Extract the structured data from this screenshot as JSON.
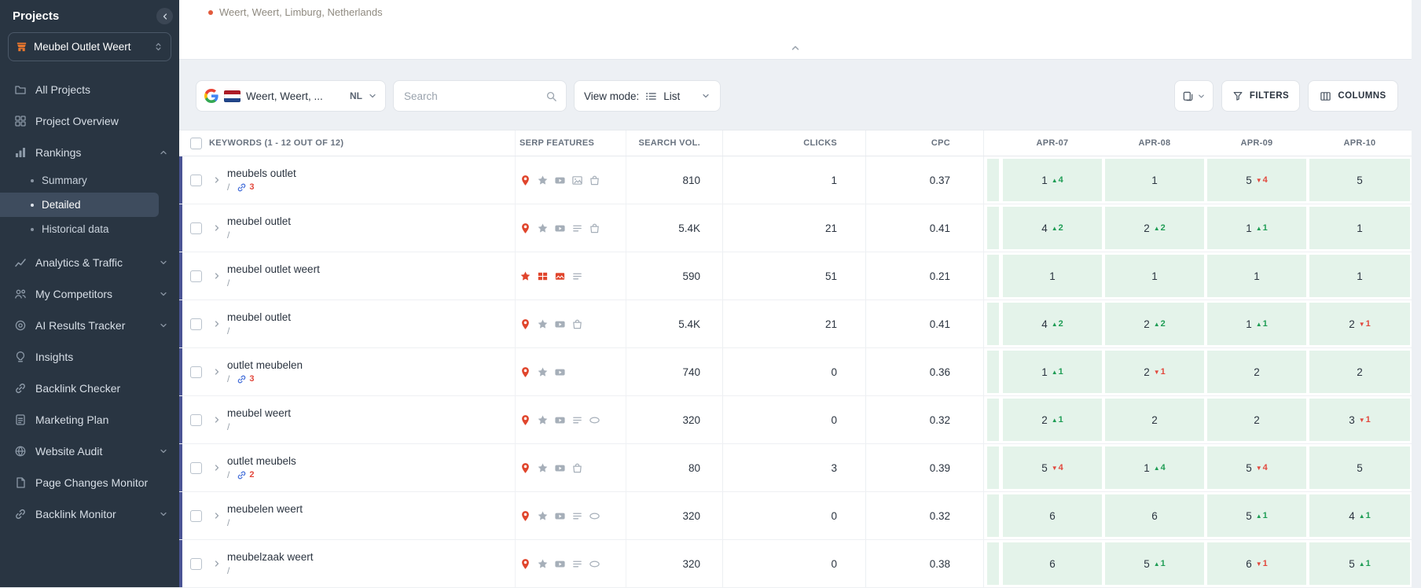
{
  "colors": {
    "positive": "#1f9d55",
    "negative": "#e2483d",
    "accent_bar": "#4a5494",
    "date_cell_bg": "#e4f3ea",
    "serp_red": "#e0452c",
    "serp_gray": "#a6afb9",
    "link_blue": "#3f6ad8",
    "sidebar_bg": "#293542",
    "location_dot": "#e25a3c"
  },
  "sidebar": {
    "title": "Projects",
    "project_name": "Meubel Outlet Weert",
    "items": [
      {
        "label": "All Projects",
        "icon": "folder"
      },
      {
        "label": "Project Overview",
        "icon": "overview"
      },
      {
        "label": "Rankings",
        "icon": "rankings",
        "expanded": true,
        "children": [
          {
            "label": "Summary"
          },
          {
            "label": "Detailed",
            "active": true
          },
          {
            "label": "Historical data"
          }
        ]
      },
      {
        "label": "Analytics & Traffic",
        "icon": "analytics",
        "expandable": true
      },
      {
        "label": "My Competitors",
        "icon": "competitors",
        "expandable": true
      },
      {
        "label": "AI Results Tracker",
        "icon": "ai-tracker",
        "expandable": true
      },
      {
        "label": "Insights",
        "icon": "insights"
      },
      {
        "label": "Backlink Checker",
        "icon": "link"
      },
      {
        "label": "Marketing Plan",
        "icon": "marketing"
      },
      {
        "label": "Website Audit",
        "icon": "website-audit",
        "expandable": true
      },
      {
        "label": "Page Changes Monitor",
        "icon": "page-changes"
      },
      {
        "label": "Backlink Monitor",
        "icon": "link",
        "expandable": true
      }
    ]
  },
  "header_panel": {
    "location_full": "Weert, Weert, Limburg, Netherlands"
  },
  "toolbar": {
    "location": {
      "engine_icon": "google-g",
      "flag_icon": "flag-nl",
      "label": "Weert, Weert, ...",
      "country_code": "NL"
    },
    "search": {
      "placeholder": "Search",
      "icon": "magnifier"
    },
    "view_mode": {
      "label": "View mode:",
      "icon": "view-list",
      "value": "List"
    },
    "export": {
      "icon": "copy"
    },
    "filters": {
      "label": "FILTERS",
      "icon": "funnel"
    },
    "columns": {
      "label": "COLUMNS",
      "icon": "columns"
    }
  },
  "table": {
    "headers": {
      "keywords": "KEYWORDS (1 - 12 OUT OF 12)",
      "serp": "SERP FEATURES",
      "volume": "SEARCH VOL.",
      "clicks": "CLICKS",
      "cpc": "CPC",
      "dates": [
        "APR-07",
        "APR-08",
        "APR-09",
        "APR-10"
      ]
    },
    "rows": [
      {
        "keyword": "meubels outlet",
        "url": "/",
        "links": "3",
        "serp": [
          {
            "icon": "map-pin",
            "color": "red"
          },
          {
            "icon": "star",
            "color": "gray"
          },
          {
            "icon": "video",
            "color": "gray"
          },
          {
            "icon": "image",
            "color": "gray"
          },
          {
            "icon": "bag",
            "color": "gray"
          }
        ],
        "volume": "810",
        "clicks": "1",
        "cpc": "0.37",
        "positions": [
          {
            "value": "1",
            "change": "4",
            "dir": "up"
          },
          {
            "value": "1"
          },
          {
            "value": "5",
            "change": "4",
            "dir": "down"
          },
          {
            "value": "5"
          }
        ]
      },
      {
        "keyword": "meubel outlet",
        "url": "/",
        "serp": [
          {
            "icon": "map-pin",
            "color": "red"
          },
          {
            "icon": "star",
            "color": "gray"
          },
          {
            "icon": "video",
            "color": "gray"
          },
          {
            "icon": "list",
            "color": "gray"
          },
          {
            "icon": "bag",
            "color": "gray"
          }
        ],
        "volume": "5.4K",
        "clicks": "21",
        "cpc": "0.41",
        "positions": [
          {
            "value": "4",
            "change": "2",
            "dir": "up"
          },
          {
            "value": "2",
            "change": "2",
            "dir": "up"
          },
          {
            "value": "1",
            "change": "1",
            "dir": "up"
          },
          {
            "value": "1"
          }
        ]
      },
      {
        "keyword": "meubel outlet weert",
        "url": "/",
        "serp": [
          {
            "icon": "star",
            "color": "red"
          },
          {
            "icon": "table",
            "color": "red"
          },
          {
            "icon": "image-pack",
            "color": "red"
          },
          {
            "icon": "list",
            "color": "gray"
          }
        ],
        "volume": "590",
        "clicks": "51",
        "cpc": "0.21",
        "positions": [
          {
            "value": "1"
          },
          {
            "value": "1"
          },
          {
            "value": "1"
          },
          {
            "value": "1"
          }
        ]
      },
      {
        "keyword": "meubel outlet",
        "url": "/",
        "serp": [
          {
            "icon": "map-pin",
            "color": "red"
          },
          {
            "icon": "star",
            "color": "gray"
          },
          {
            "icon": "video",
            "color": "gray"
          },
          {
            "icon": "bag",
            "color": "gray"
          }
        ],
        "volume": "5.4K",
        "clicks": "21",
        "cpc": "0.41",
        "positions": [
          {
            "value": "4",
            "change": "2",
            "dir": "up"
          },
          {
            "value": "2",
            "change": "2",
            "dir": "up"
          },
          {
            "value": "1",
            "change": "1",
            "dir": "up"
          },
          {
            "value": "2",
            "change": "1",
            "dir": "down"
          }
        ]
      },
      {
        "keyword": "outlet meubelen",
        "url": "/",
        "links": "3",
        "serp": [
          {
            "icon": "map-pin",
            "color": "red"
          },
          {
            "icon": "star",
            "color": "gray"
          },
          {
            "icon": "video",
            "color": "gray"
          }
        ],
        "volume": "740",
        "clicks": "0",
        "cpc": "0.36",
        "positions": [
          {
            "value": "1",
            "change": "1",
            "dir": "up"
          },
          {
            "value": "2",
            "change": "1",
            "dir": "down"
          },
          {
            "value": "2"
          },
          {
            "value": "2"
          }
        ]
      },
      {
        "keyword": "meubel weert",
        "url": "/",
        "serp": [
          {
            "icon": "map-pin",
            "color": "red"
          },
          {
            "icon": "star",
            "color": "gray"
          },
          {
            "icon": "video",
            "color": "gray"
          },
          {
            "icon": "list",
            "color": "gray"
          },
          {
            "icon": "pill",
            "color": "gray"
          }
        ],
        "volume": "320",
        "clicks": "0",
        "cpc": "0.32",
        "positions": [
          {
            "value": "2",
            "change": "1",
            "dir": "up"
          },
          {
            "value": "2"
          },
          {
            "value": "2"
          },
          {
            "value": "3",
            "change": "1",
            "dir": "down"
          }
        ]
      },
      {
        "keyword": "outlet meubels",
        "url": "/",
        "links": "2",
        "serp": [
          {
            "icon": "map-pin",
            "color": "red"
          },
          {
            "icon": "star",
            "color": "gray"
          },
          {
            "icon": "video",
            "color": "gray"
          },
          {
            "icon": "bag",
            "color": "gray"
          }
        ],
        "volume": "80",
        "clicks": "3",
        "cpc": "0.39",
        "positions": [
          {
            "value": "5",
            "change": "4",
            "dir": "down"
          },
          {
            "value": "1",
            "change": "4",
            "dir": "up"
          },
          {
            "value": "5",
            "change": "4",
            "dir": "down"
          },
          {
            "value": "5"
          }
        ]
      },
      {
        "keyword": "meubelen weert",
        "url": "/",
        "serp": [
          {
            "icon": "map-pin",
            "color": "red"
          },
          {
            "icon": "star",
            "color": "gray"
          },
          {
            "icon": "video",
            "color": "gray"
          },
          {
            "icon": "list",
            "color": "gray"
          },
          {
            "icon": "pill",
            "color": "gray"
          }
        ],
        "volume": "320",
        "clicks": "0",
        "cpc": "0.32",
        "positions": [
          {
            "value": "6"
          },
          {
            "value": "6"
          },
          {
            "value": "5",
            "change": "1",
            "dir": "up"
          },
          {
            "value": "4",
            "change": "1",
            "dir": "up"
          }
        ]
      },
      {
        "keyword": "meubelzaak weert",
        "url": "/",
        "serp": [
          {
            "icon": "map-pin",
            "color": "red"
          },
          {
            "icon": "star",
            "color": "gray"
          },
          {
            "icon": "video",
            "color": "gray"
          },
          {
            "icon": "list",
            "color": "gray"
          },
          {
            "icon": "pill",
            "color": "gray"
          }
        ],
        "volume": "320",
        "clicks": "0",
        "cpc": "0.38",
        "positions": [
          {
            "value": "6"
          },
          {
            "value": "5",
            "change": "1",
            "dir": "up"
          },
          {
            "value": "6",
            "change": "1",
            "dir": "down"
          },
          {
            "value": "5",
            "change": "1",
            "dir": "up"
          }
        ]
      }
    ]
  }
}
